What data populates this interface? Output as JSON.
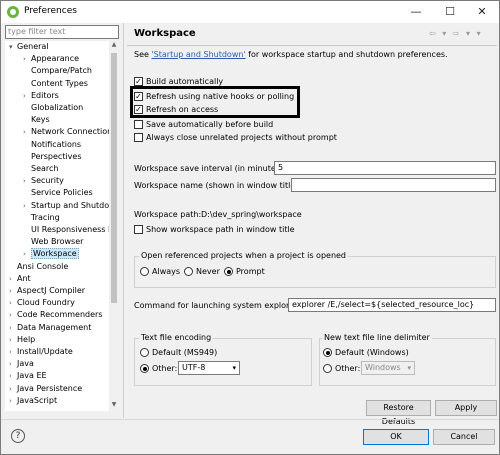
{
  "window": {
    "title": "Preferences"
  },
  "filter": {
    "placeholder": "type filter text"
  },
  "tree": [
    {
      "label": "General",
      "arrow": "⌄",
      "indent": 0
    },
    {
      "label": "Appearance",
      "arrow": "›",
      "indent": 1
    },
    {
      "label": "Compare/Patch",
      "arrow": "",
      "indent": 1
    },
    {
      "label": "Content Types",
      "arrow": "",
      "indent": 1
    },
    {
      "label": "Editors",
      "arrow": "›",
      "indent": 1
    },
    {
      "label": "Globalization",
      "arrow": "",
      "indent": 1
    },
    {
      "label": "Keys",
      "arrow": "",
      "indent": 1
    },
    {
      "label": "Network Connection",
      "arrow": "›",
      "indent": 1
    },
    {
      "label": "Notifications",
      "arrow": "",
      "indent": 1
    },
    {
      "label": "Perspectives",
      "arrow": "",
      "indent": 1
    },
    {
      "label": "Search",
      "arrow": "",
      "indent": 1
    },
    {
      "label": "Security",
      "arrow": "›",
      "indent": 1
    },
    {
      "label": "Service Policies",
      "arrow": "",
      "indent": 1
    },
    {
      "label": "Startup and Shutdown",
      "arrow": "›",
      "indent": 1
    },
    {
      "label": "Tracing",
      "arrow": "",
      "indent": 1
    },
    {
      "label": "UI Responsiveness Monitoring",
      "arrow": "",
      "indent": 1
    },
    {
      "label": "Web Browser",
      "arrow": "",
      "indent": 1
    },
    {
      "label": "Workspace",
      "arrow": "›",
      "indent": 1,
      "selected": true
    },
    {
      "label": "Ansi Console",
      "arrow": "",
      "indent": 0
    },
    {
      "label": "Ant",
      "arrow": "›",
      "indent": 0
    },
    {
      "label": "AspectJ Compiler",
      "arrow": "›",
      "indent": 0
    },
    {
      "label": "Cloud Foundry",
      "arrow": "›",
      "indent": 0
    },
    {
      "label": "Code Recommenders",
      "arrow": "›",
      "indent": 0
    },
    {
      "label": "Data Management",
      "arrow": "›",
      "indent": 0
    },
    {
      "label": "Help",
      "arrow": "›",
      "indent": 0
    },
    {
      "label": "Install/Update",
      "arrow": "›",
      "indent": 0
    },
    {
      "label": "Java",
      "arrow": "›",
      "indent": 0
    },
    {
      "label": "Java EE",
      "arrow": "›",
      "indent": 0
    },
    {
      "label": "Java Persistence",
      "arrow": "›",
      "indent": 0
    },
    {
      "label": "JavaScript",
      "arrow": "›",
      "indent": 0
    }
  ],
  "page": {
    "title": "Workspace",
    "see_prefix": "See ",
    "see_link": "'Startup and Shutdown'",
    "see_suffix": " for workspace startup and shutdown preferences.",
    "build_auto": "Build automatically",
    "refresh_hooks": "Refresh using native hooks or polling",
    "refresh_access": "Refresh on access",
    "save_auto": "Save automatically before build",
    "close_unrelated": "Always close unrelated projects without prompt",
    "save_interval_label": "Workspace save interval (in minutes):",
    "save_interval_value": "5",
    "ws_name_label": "Workspace name (shown in window title):",
    "ws_name_value": "",
    "ws_path_label": "Workspace path:",
    "ws_path_value": "D:\\dev_spring\\workspace",
    "show_path": "Show workspace path in window title",
    "open_ref_label": "Open referenced projects when a project is opened",
    "open_always": "Always",
    "open_never": "Never",
    "open_prompt": "Prompt",
    "cmd_label": "Command for launching system explorer:",
    "cmd_value": "explorer /E,/select=${selected_resource_loc}",
    "encoding_label": "Text file encoding",
    "enc_default": "Default (MS949)",
    "enc_other": "Other:",
    "enc_other_value": "UTF-8",
    "delim_label": "New text file line delimiter",
    "delim_default": "Default (Windows)",
    "delim_other": "Other:",
    "delim_other_value": "Windows",
    "restore_defaults": "Restore Defaults",
    "apply": "Apply"
  },
  "footer": {
    "ok": "OK",
    "cancel": "Cancel",
    "help": "?"
  }
}
